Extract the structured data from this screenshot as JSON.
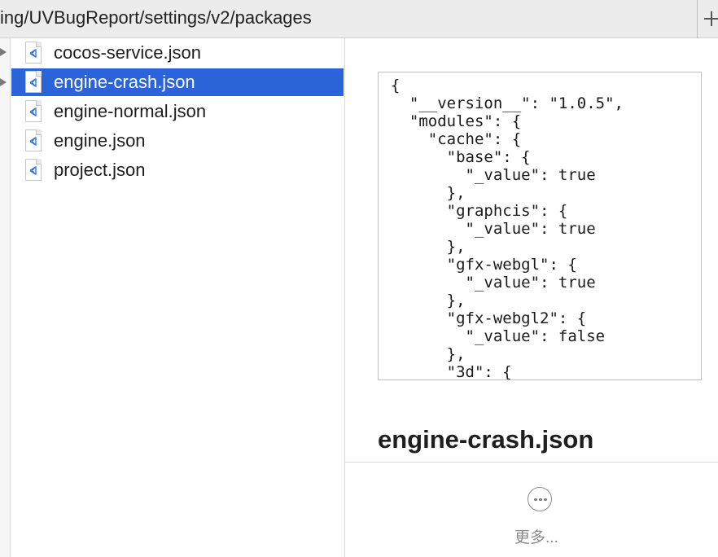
{
  "path_bar": {
    "path": "ing/UVBugReport/settings/v2/packages",
    "add_icon": "plus-icon"
  },
  "file_list": {
    "items": [
      {
        "label": "cocos-service.json",
        "icon": "vscode-json-file-icon",
        "selected": false
      },
      {
        "label": "engine-crash.json",
        "icon": "vscode-json-file-icon",
        "selected": true
      },
      {
        "label": "engine-normal.json",
        "icon": "vscode-json-file-icon",
        "selected": false
      },
      {
        "label": "engine.json",
        "icon": "vscode-json-file-icon",
        "selected": false
      },
      {
        "label": "project.json",
        "icon": "vscode-json-file-icon",
        "selected": false
      }
    ]
  },
  "preview": {
    "content": "{\n  \"__version__\": \"1.0.5\",\n  \"modules\": {\n    \"cache\": {\n      \"base\": {\n        \"_value\": true\n      },\n      \"graphcis\": {\n        \"_value\": true\n      },\n      \"gfx-webgl\": {\n        \"_value\": true\n      },\n      \"gfx-webgl2\": {\n        \"_value\": false\n      },\n      \"3d\": {",
    "title": "engine-crash.json",
    "more_label": "更多...",
    "more_icon": "ellipsis-circle-icon"
  },
  "colors": {
    "selection": "#2a64d8",
    "vscode_blue": "#2f7ad6",
    "path_bar_bg": "#ececec"
  }
}
